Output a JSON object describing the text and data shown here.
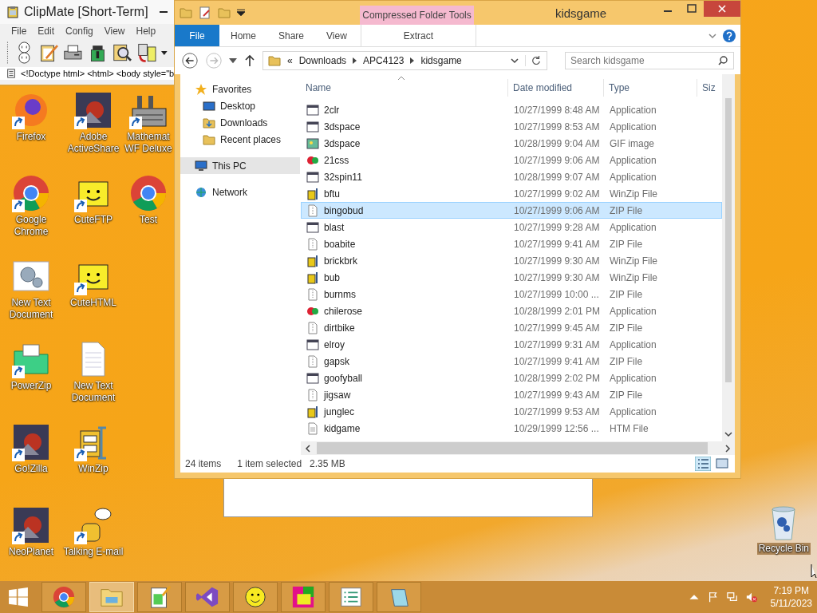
{
  "clipmate": {
    "title": "ClipMate [Short-Term]",
    "menu": [
      "File",
      "Edit",
      "Config",
      "View",
      "Help"
    ],
    "clip_preview": "<!Doctype html> <html> <body style=\"b"
  },
  "desktop": {
    "icon_rows": [
      [
        {
          "label": "Firefox",
          "kind": "firefox",
          "shortcut": true
        },
        {
          "label": "Adobe ActiveShare",
          "kind": "picture",
          "shortcut": true
        },
        {
          "label": "Mathemat WF Deluxe",
          "kind": "factory",
          "shortcut": true
        }
      ],
      [
        {
          "label": "Google Chrome",
          "kind": "chrome",
          "shortcut": true
        },
        {
          "label": "CuteFTP",
          "kind": "smiley",
          "shortcut": true
        },
        {
          "label": "Test",
          "kind": "chrome",
          "shortcut": false
        }
      ],
      [
        {
          "label": "New Text Document",
          "kind": "gears",
          "shortcut": false
        },
        {
          "label": "CuteHTML",
          "kind": "smiley",
          "shortcut": true
        }
      ],
      [
        {
          "label": "PowerZip",
          "kind": "folder",
          "shortcut": true
        },
        {
          "label": "New Text Document",
          "kind": "document",
          "shortcut": false
        }
      ],
      [
        {
          "label": "Go!Zilla",
          "kind": "picture",
          "shortcut": true
        },
        {
          "label": "WinZip",
          "kind": "cabinet",
          "shortcut": true
        }
      ],
      [
        {
          "label": "NeoPlanet",
          "kind": "picture",
          "shortcut": true
        },
        {
          "label": "Talking E-mail",
          "kind": "talk",
          "shortcut": true
        }
      ]
    ],
    "recycle_bin": {
      "label": "Recycle Bin"
    }
  },
  "explorer": {
    "title": "kidsgame",
    "context_tab_group": "Compressed Folder Tools",
    "ribbon_tabs": [
      {
        "label": "File",
        "kind": "file",
        "selected": false
      },
      {
        "label": "Home",
        "kind": "tab",
        "selected": false
      },
      {
        "label": "Share",
        "kind": "tab",
        "selected": false
      },
      {
        "label": "View",
        "kind": "tab",
        "selected": false
      },
      {
        "label": "Extract",
        "kind": "context",
        "selected": false
      }
    ],
    "address": {
      "overflow": "«",
      "crumbs": [
        "Downloads",
        "APC4123",
        "kidsgame"
      ]
    },
    "search": {
      "placeholder": "Search kidsgame"
    },
    "nav": [
      {
        "label": "Favorites",
        "kind": "star",
        "selected": false,
        "children": [
          {
            "label": "Desktop",
            "kind": "desktop",
            "selected": false
          },
          {
            "label": "Downloads",
            "kind": "downloads",
            "selected": false
          },
          {
            "label": "Recent places",
            "kind": "recent",
            "selected": false
          }
        ]
      },
      {
        "label": "This PC",
        "kind": "pc",
        "selected": true
      },
      {
        "label": "Network",
        "kind": "network",
        "selected": false
      }
    ],
    "columns": [
      "Name",
      "Date modified",
      "Type",
      "Siz"
    ],
    "files": [
      {
        "name": "2clr",
        "date": "10/27/1999 8:48 AM",
        "type": "Application",
        "kind": "app",
        "selected": false
      },
      {
        "name": "3dspace",
        "date": "10/27/1999 8:53 AM",
        "type": "Application",
        "kind": "app",
        "selected": false
      },
      {
        "name": "3dspace",
        "date": "10/28/1999 9:04 AM",
        "type": "GIF image",
        "kind": "gif",
        "selected": false
      },
      {
        "name": "21css",
        "date": "10/27/1999 9:06 AM",
        "type": "Application",
        "kind": "app2",
        "selected": false
      },
      {
        "name": "32spin11",
        "date": "10/28/1999 9:07 AM",
        "type": "Application",
        "kind": "app",
        "selected": false
      },
      {
        "name": "bftu",
        "date": "10/27/1999 9:02 AM",
        "type": "WinZip File",
        "kind": "winzip",
        "selected": false
      },
      {
        "name": "bingobud",
        "date": "10/27/1999 9:06 AM",
        "type": "ZIP File",
        "kind": "zip",
        "selected": true
      },
      {
        "name": "blast",
        "date": "10/27/1999 9:28 AM",
        "type": "Application",
        "kind": "app",
        "selected": false
      },
      {
        "name": "boabite",
        "date": "10/27/1999 9:41 AM",
        "type": "ZIP File",
        "kind": "zip",
        "selected": false
      },
      {
        "name": "brickbrk",
        "date": "10/27/1999 9:30 AM",
        "type": "WinZip File",
        "kind": "winzip",
        "selected": false
      },
      {
        "name": "bub",
        "date": "10/27/1999 9:30 AM",
        "type": "WinZip File",
        "kind": "winzip",
        "selected": false
      },
      {
        "name": "burnms",
        "date": "10/27/1999 10:00 ...",
        "type": "ZIP File",
        "kind": "zip",
        "selected": false
      },
      {
        "name": "chilerose",
        "date": "10/28/1999 2:01 PM",
        "type": "Application",
        "kind": "app2",
        "selected": false
      },
      {
        "name": "dirtbike",
        "date": "10/27/1999 9:45 AM",
        "type": "ZIP File",
        "kind": "zip",
        "selected": false
      },
      {
        "name": "elroy",
        "date": "10/27/1999 9:31 AM",
        "type": "Application",
        "kind": "app",
        "selected": false
      },
      {
        "name": "gapsk",
        "date": "10/27/1999 9:41 AM",
        "type": "ZIP File",
        "kind": "zip",
        "selected": false
      },
      {
        "name": "goofyball",
        "date": "10/28/1999 2:02 PM",
        "type": "Application",
        "kind": "app",
        "selected": false
      },
      {
        "name": "jigsaw",
        "date": "10/27/1999 9:43 AM",
        "type": "ZIP File",
        "kind": "zip",
        "selected": false
      },
      {
        "name": "junglec",
        "date": "10/27/1999 9:53 AM",
        "type": "Application",
        "kind": "winzip",
        "selected": false
      },
      {
        "name": "kidgame",
        "date": "10/29/1999 12:56 ...",
        "type": "HTM File",
        "kind": "htm",
        "selected": false
      }
    ],
    "status": {
      "count": "24 items",
      "selection": "1 item selected",
      "size": "2.35 MB"
    }
  },
  "taskbar": {
    "apps": [
      {
        "kind": "chrome",
        "selected": false
      },
      {
        "kind": "explorer",
        "selected": true
      },
      {
        "kind": "notepadpp",
        "selected": false
      },
      {
        "kind": "vs",
        "selected": false
      },
      {
        "kind": "smiley",
        "selected": false
      },
      {
        "kind": "grid",
        "selected": false
      },
      {
        "kind": "list",
        "selected": false
      },
      {
        "kind": "notepad",
        "selected": false
      }
    ],
    "time": "7:19 PM",
    "date": "5/11/2023"
  }
}
